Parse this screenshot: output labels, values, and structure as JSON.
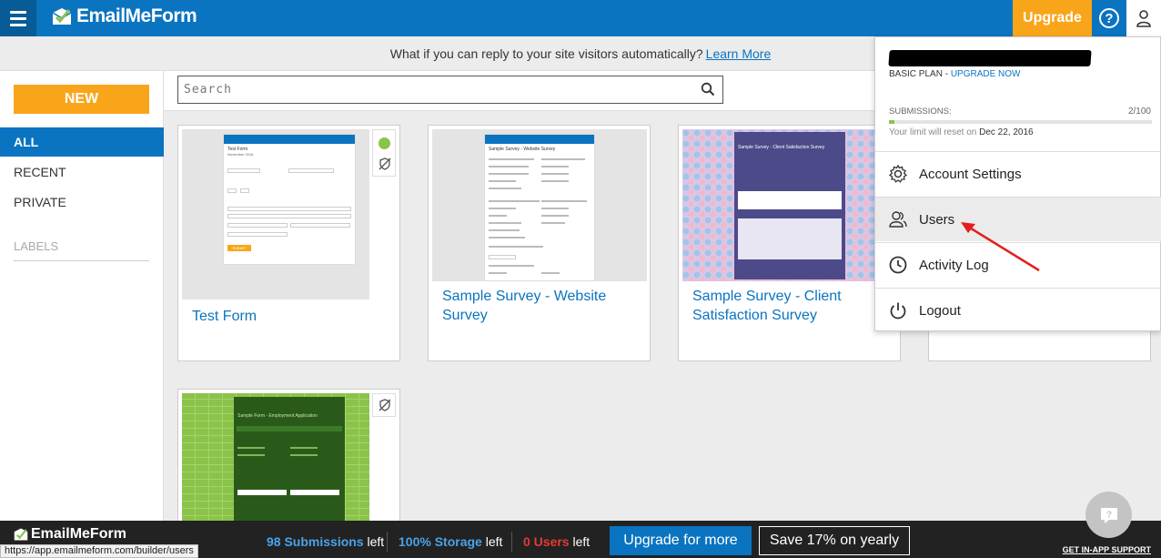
{
  "header": {
    "brand": "EmailMeForm",
    "upgrade_label": "Upgrade",
    "help_glyph": "?"
  },
  "promo": {
    "text": "What if you can reply to your site visitors automatically?",
    "link": "Learn More"
  },
  "sidebar": {
    "new_label": "NEW",
    "items": [
      {
        "label": "ALL",
        "active": true
      },
      {
        "label": "RECENT",
        "active": false
      },
      {
        "label": "PRIVATE",
        "active": false
      }
    ],
    "labels_heading": "LABELS"
  },
  "search": {
    "placeholder": "Search"
  },
  "forms": [
    {
      "title": "Test Form",
      "thumb_title": "Test Form",
      "thumb_subtitle": "November 2016",
      "submit": "SUBMIT"
    },
    {
      "title": "Sample Survey - Website Survey",
      "thumb_title": "Sample Survey - Website Survey"
    },
    {
      "title": "Sample Survey - Client Satisfaction Survey",
      "thumb_title": "Sample Survey - Client Satisfaction Survey"
    },
    {
      "title": "",
      "thumb_title": "Sample Form - Employment Application"
    }
  ],
  "account_menu": {
    "plan": "BASIC PLAN",
    "plan_sep": " - ",
    "upgrade_link": "UPGRADE NOW",
    "submissions_label": "SUBMISSIONS:",
    "submissions_count": "2/100",
    "submissions_used_fraction": 0.02,
    "reset_prefix": "Your limit will reset on",
    "reset_date": "Dec 22, 2016",
    "items": [
      {
        "label": "Account Settings",
        "icon": "gear-icon"
      },
      {
        "label": "Users",
        "icon": "users-icon"
      },
      {
        "label": "Activity Log",
        "icon": "clock-icon"
      },
      {
        "label": "Logout",
        "icon": "power-icon"
      }
    ]
  },
  "footer": {
    "brand": "EmailMeForm",
    "submissions_value": "98 Submissions",
    "storage_value": "100% Storage",
    "users_value": "0 Users",
    "left_word": "left",
    "upgrade_label": "Upgrade for more",
    "save_label": "Save 17% on yearly",
    "support_label": "GET IN-APP SUPPORT"
  },
  "status_url": "https://app.emailmeform.com/builder/users",
  "colors": {
    "brand_blue": "#0a74c0",
    "accent_orange": "#f9a51a",
    "arrow_red": "#e0201a"
  }
}
